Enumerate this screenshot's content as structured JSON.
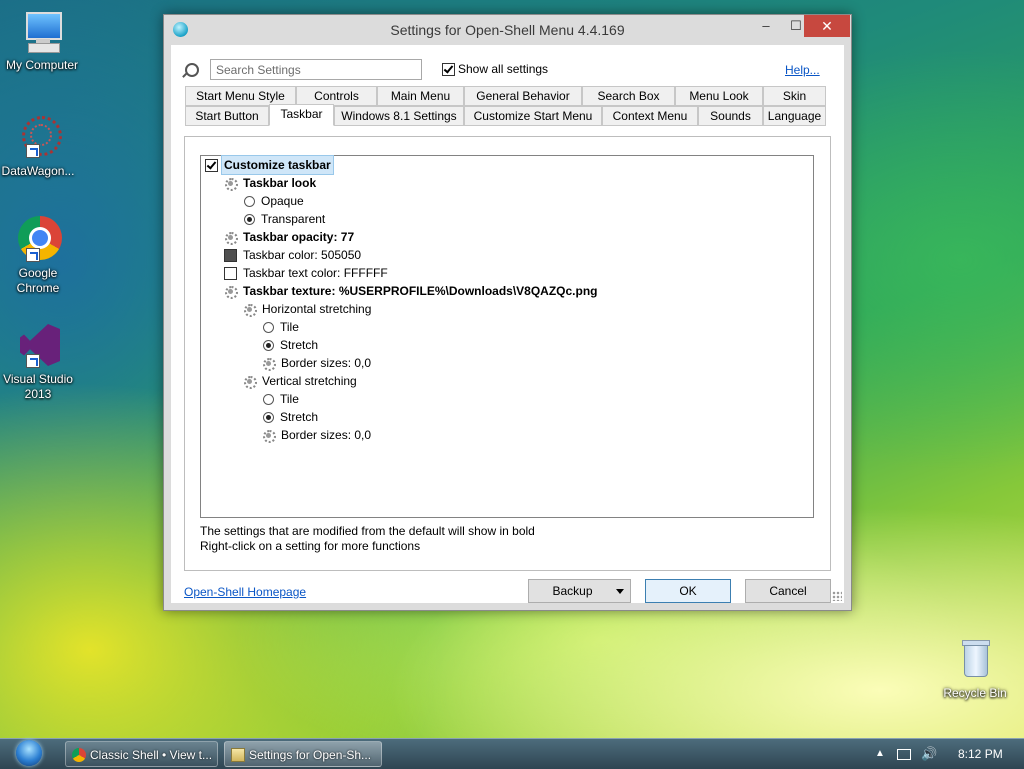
{
  "desktop": {
    "icons": [
      {
        "label": "My Computer"
      },
      {
        "label": "DataWagon..."
      },
      {
        "label": "Google Chrome"
      },
      {
        "label": "Visual Studio 2013"
      },
      {
        "label": "Recycle Bin"
      }
    ]
  },
  "window": {
    "title": "Settings for Open-Shell Menu 4.4.169",
    "controls": {
      "minimize": "–",
      "maximize": "☐",
      "close": "✕"
    }
  },
  "toolbar": {
    "search_placeholder": "Search Settings",
    "show_all_label": "Show all settings",
    "show_all_checked": true,
    "help_label": "Help..."
  },
  "tabs": {
    "row1": [
      "Start Menu Style",
      "Controls",
      "Main Menu",
      "General Behavior",
      "Search Box",
      "Menu Look",
      "Skin"
    ],
    "row2": [
      "Start Button",
      "Taskbar",
      "Windows 8.1 Settings",
      "Customize Start Menu",
      "Context Menu",
      "Sounds",
      "Language"
    ],
    "active": "Taskbar"
  },
  "tree": {
    "customize_taskbar": "Customize taskbar",
    "taskbar_look": "Taskbar look",
    "opaque": "Opaque",
    "transparent": "Transparent",
    "taskbar_opacity": "Taskbar opacity: 77",
    "taskbar_color": "Taskbar color: 505050",
    "taskbar_text_color": "Taskbar text color: FFFFFF",
    "taskbar_texture": "Taskbar texture: %USERPROFILE%\\Downloads\\V8QAZQc.png",
    "horizontal_stretching": "Horizontal stretching",
    "h_tile": "Tile",
    "h_stretch": "Stretch",
    "h_border": "Border sizes: 0,0",
    "vertical_stretching": "Vertical stretching",
    "v_tile": "Tile",
    "v_stretch": "Stretch",
    "v_border": "Border sizes: 0,0",
    "colors": {
      "taskbar_color": "#505050",
      "taskbar_text_color": "#FFFFFF"
    }
  },
  "info": {
    "line1": "The settings that are modified from the default will show in bold",
    "line2": "Right-click on a setting for more functions"
  },
  "footer": {
    "homepage_label": "Open-Shell Homepage",
    "backup_label": "Backup",
    "ok_label": "OK",
    "cancel_label": "Cancel"
  },
  "taskbar": {
    "buttons": [
      "Classic Shell • View t...",
      "Settings for Open-Sh..."
    ],
    "clock": "8:12 PM"
  }
}
